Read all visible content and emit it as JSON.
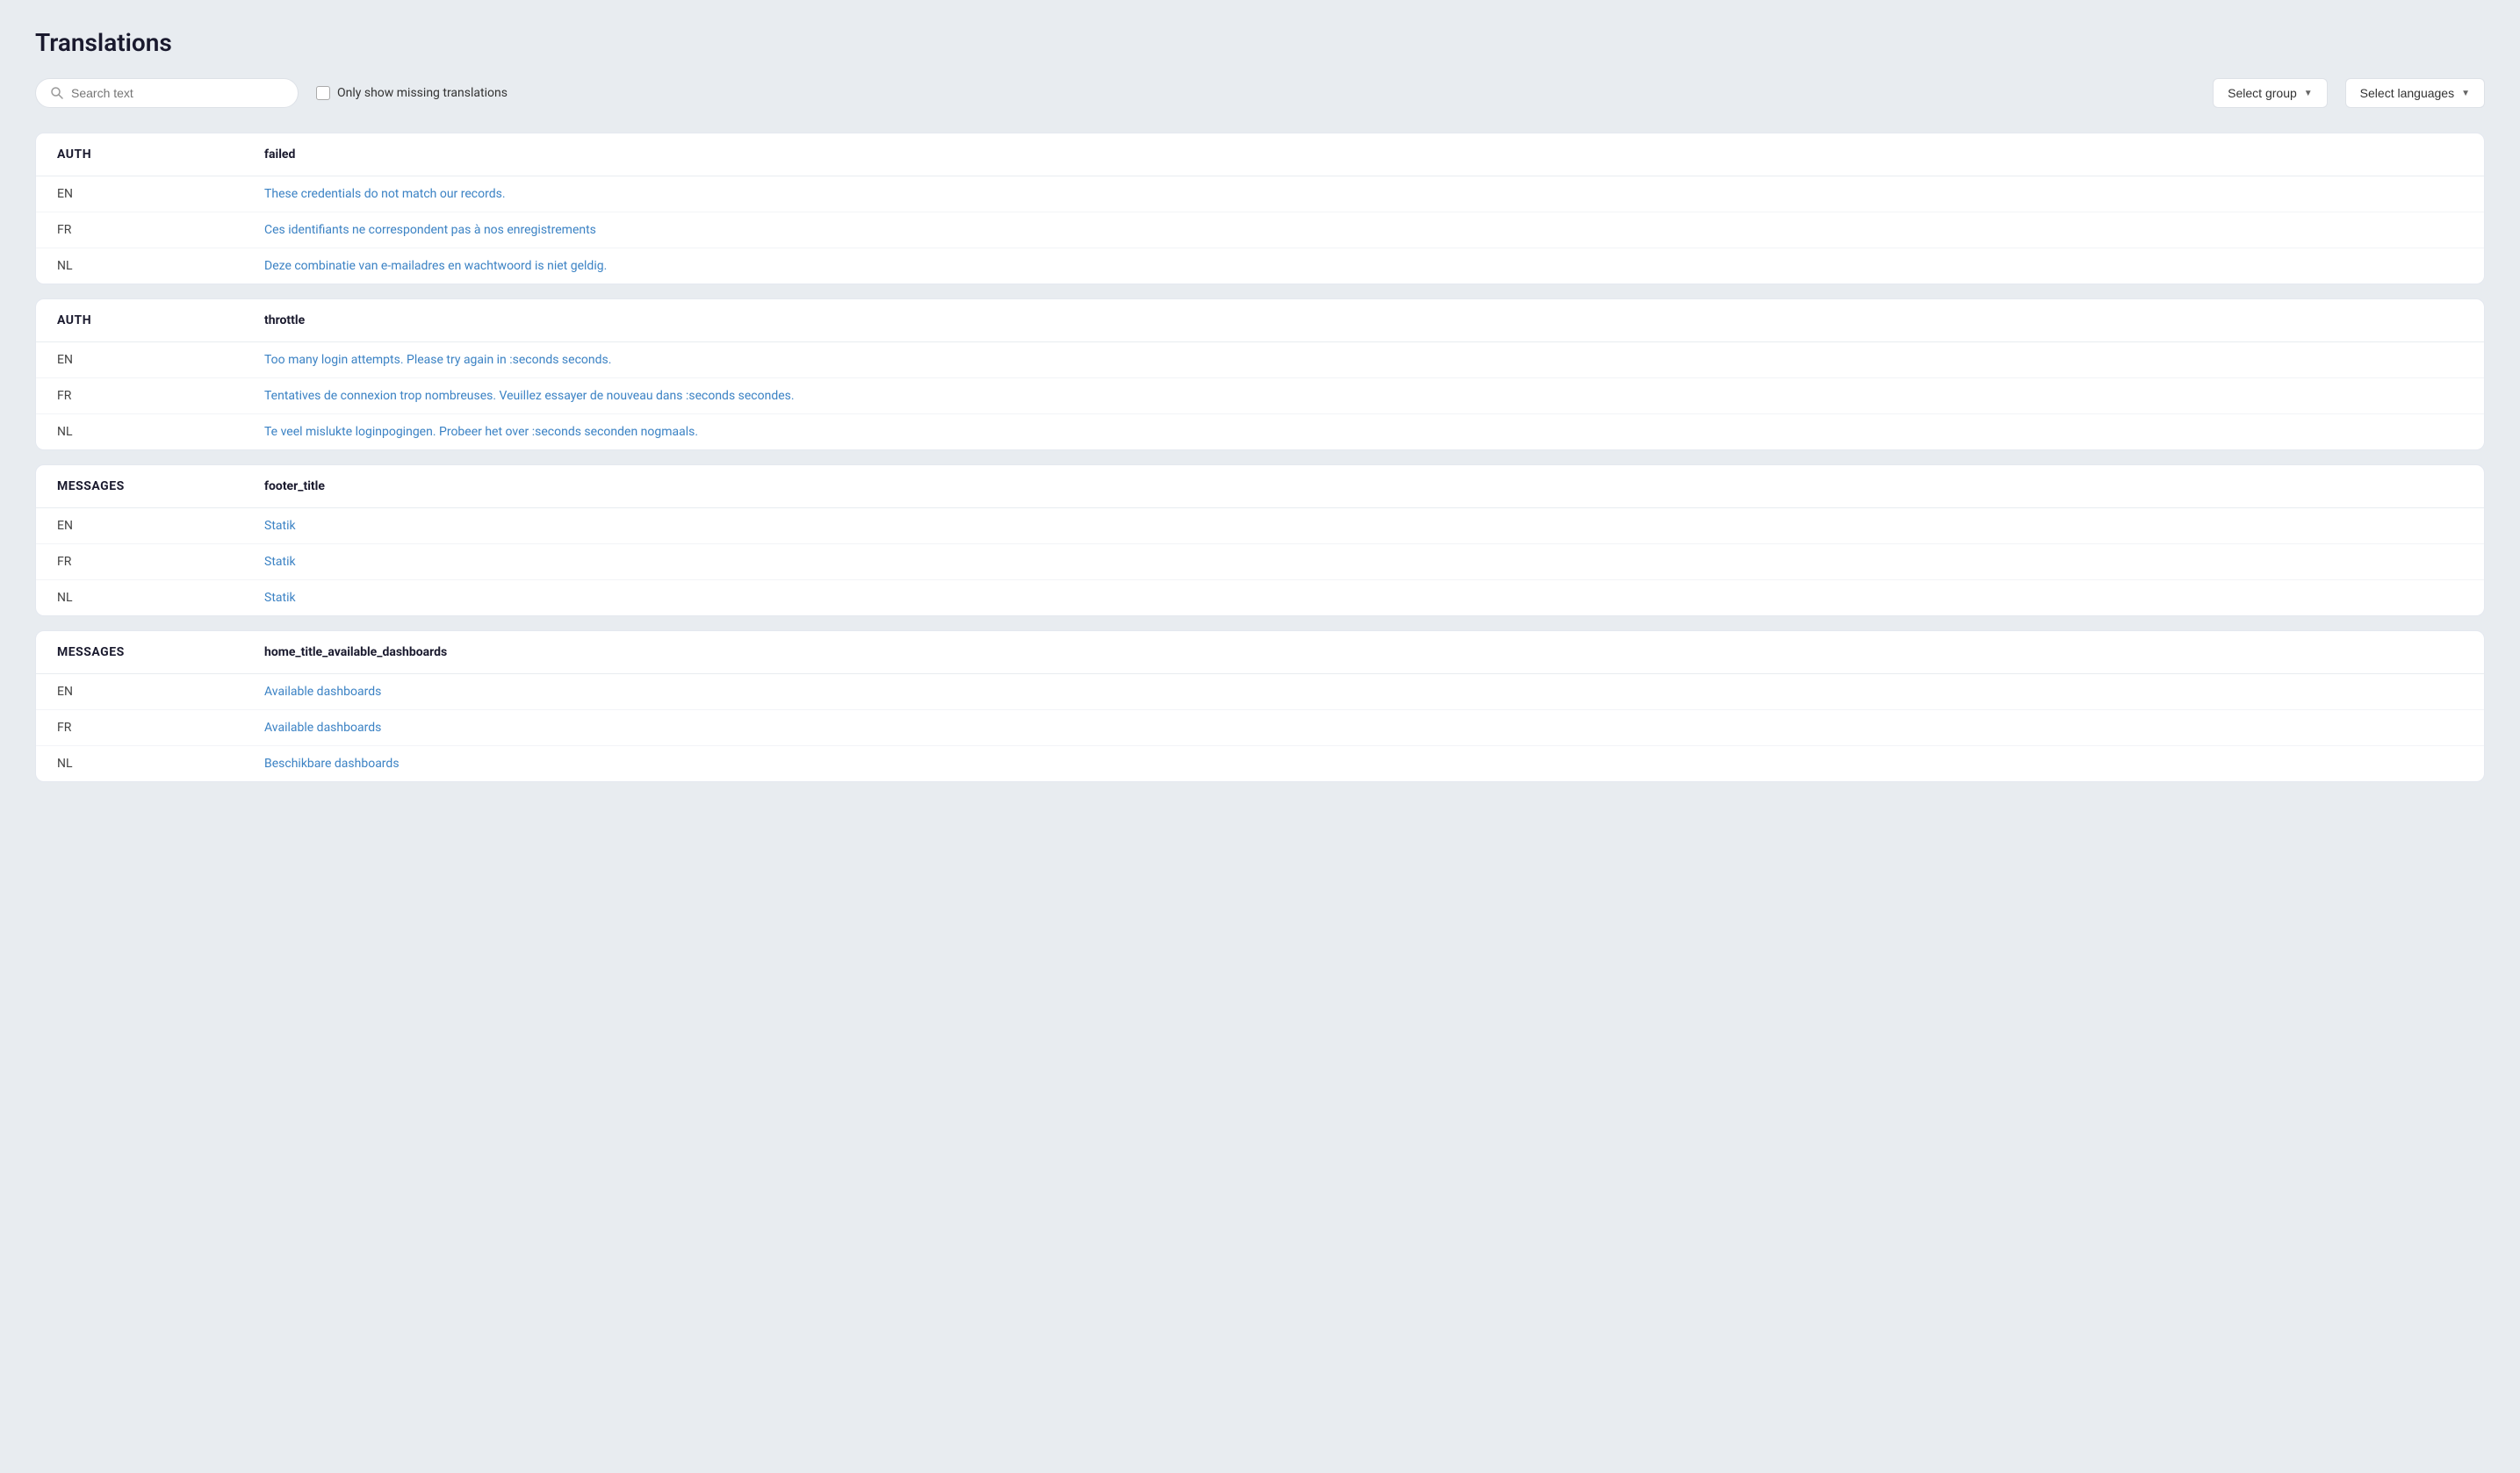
{
  "page": {
    "title": "Translations"
  },
  "toolbar": {
    "search_placeholder": "Search text",
    "checkbox_label": "Only show missing translations",
    "select_group_label": "Select group",
    "select_languages_label": "Select languages"
  },
  "cards": [
    {
      "group": "AUTH",
      "key": "failed",
      "rows": [
        {
          "lang": "EN",
          "text": "These credentials do not match our records."
        },
        {
          "lang": "FR",
          "text": "Ces identifiants ne correspondent pas à nos enregistrements"
        },
        {
          "lang": "NL",
          "text": "Deze combinatie van e-mailadres en wachtwoord is niet geldig."
        }
      ]
    },
    {
      "group": "AUTH",
      "key": "throttle",
      "rows": [
        {
          "lang": "EN",
          "text": "Too many login attempts. Please try again in :seconds seconds."
        },
        {
          "lang": "FR",
          "text": "Tentatives de connexion trop nombreuses. Veuillez essayer de nouveau dans :seconds secondes."
        },
        {
          "lang": "NL",
          "text": "Te veel mislukte loginpogingen. Probeer het over :seconds seconden nogmaals."
        }
      ]
    },
    {
      "group": "MESSAGES",
      "key": "footer_title",
      "rows": [
        {
          "lang": "EN",
          "text": "Statik"
        },
        {
          "lang": "FR",
          "text": "Statik"
        },
        {
          "lang": "NL",
          "text": "Statik"
        }
      ]
    },
    {
      "group": "MESSAGES",
      "key": "home_title_available_dashboards",
      "rows": [
        {
          "lang": "EN",
          "text": "Available dashboards"
        },
        {
          "lang": "FR",
          "text": "Available dashboards"
        },
        {
          "lang": "NL",
          "text": "Beschikbare dashboards"
        }
      ]
    }
  ]
}
